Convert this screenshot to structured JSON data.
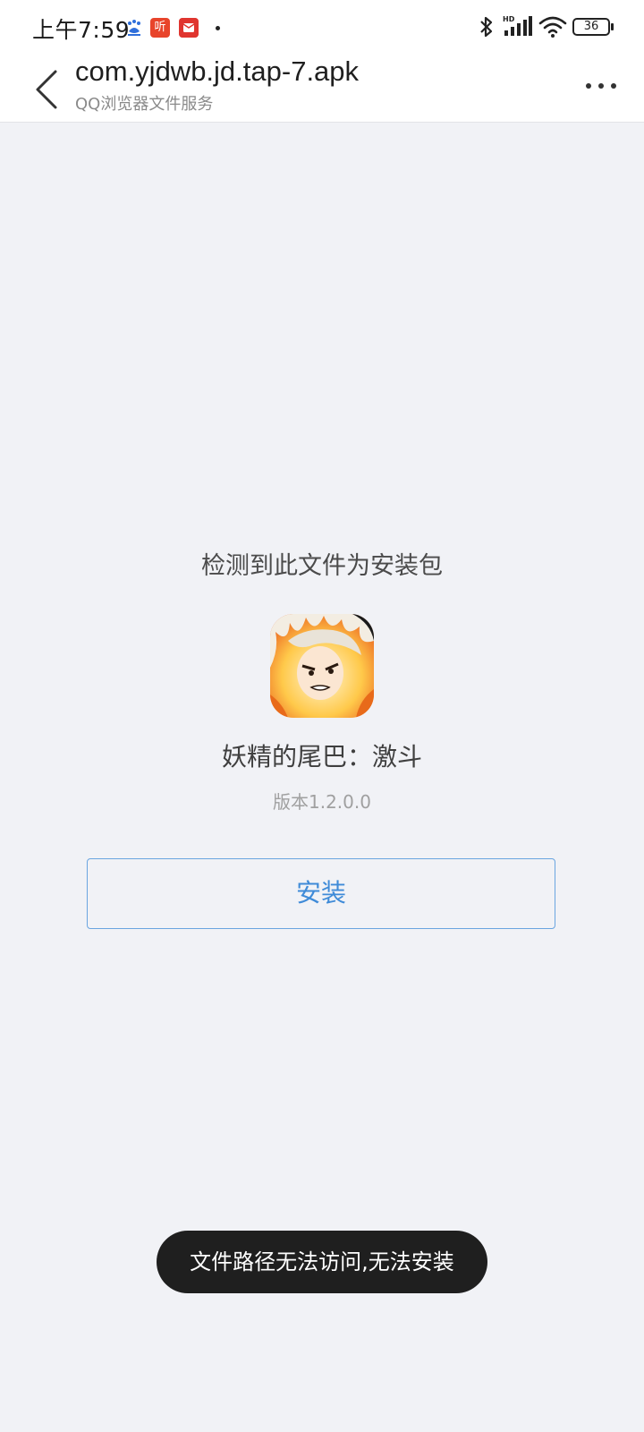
{
  "status_bar": {
    "time": "上午7:59",
    "ting_label": "听",
    "battery": "36",
    "network_label": "HD",
    "icons": [
      "baidu-icon",
      "ting-icon",
      "mail-icon",
      "dot-icon",
      "bluetooth-icon",
      "signal-icon",
      "wifi-icon",
      "battery-icon"
    ]
  },
  "header": {
    "title": "com.yjdwb.jd.tap-7.apk",
    "subtitle": "QQ浏览器文件服务",
    "back_icon": "back-arrow-icon",
    "more_icon": "more-dots-icon"
  },
  "main": {
    "detect_text": "检测到此文件为安装包",
    "app_name": "妖精的尾巴：激斗",
    "version": "版本1.2.0.0",
    "install_label": "安装"
  },
  "toast": {
    "message": "文件路径无法访问,无法安装"
  },
  "colors": {
    "background": "#f1f2f6",
    "accent": "#3f8bd8",
    "toast_bg": "#1f1f1f"
  }
}
